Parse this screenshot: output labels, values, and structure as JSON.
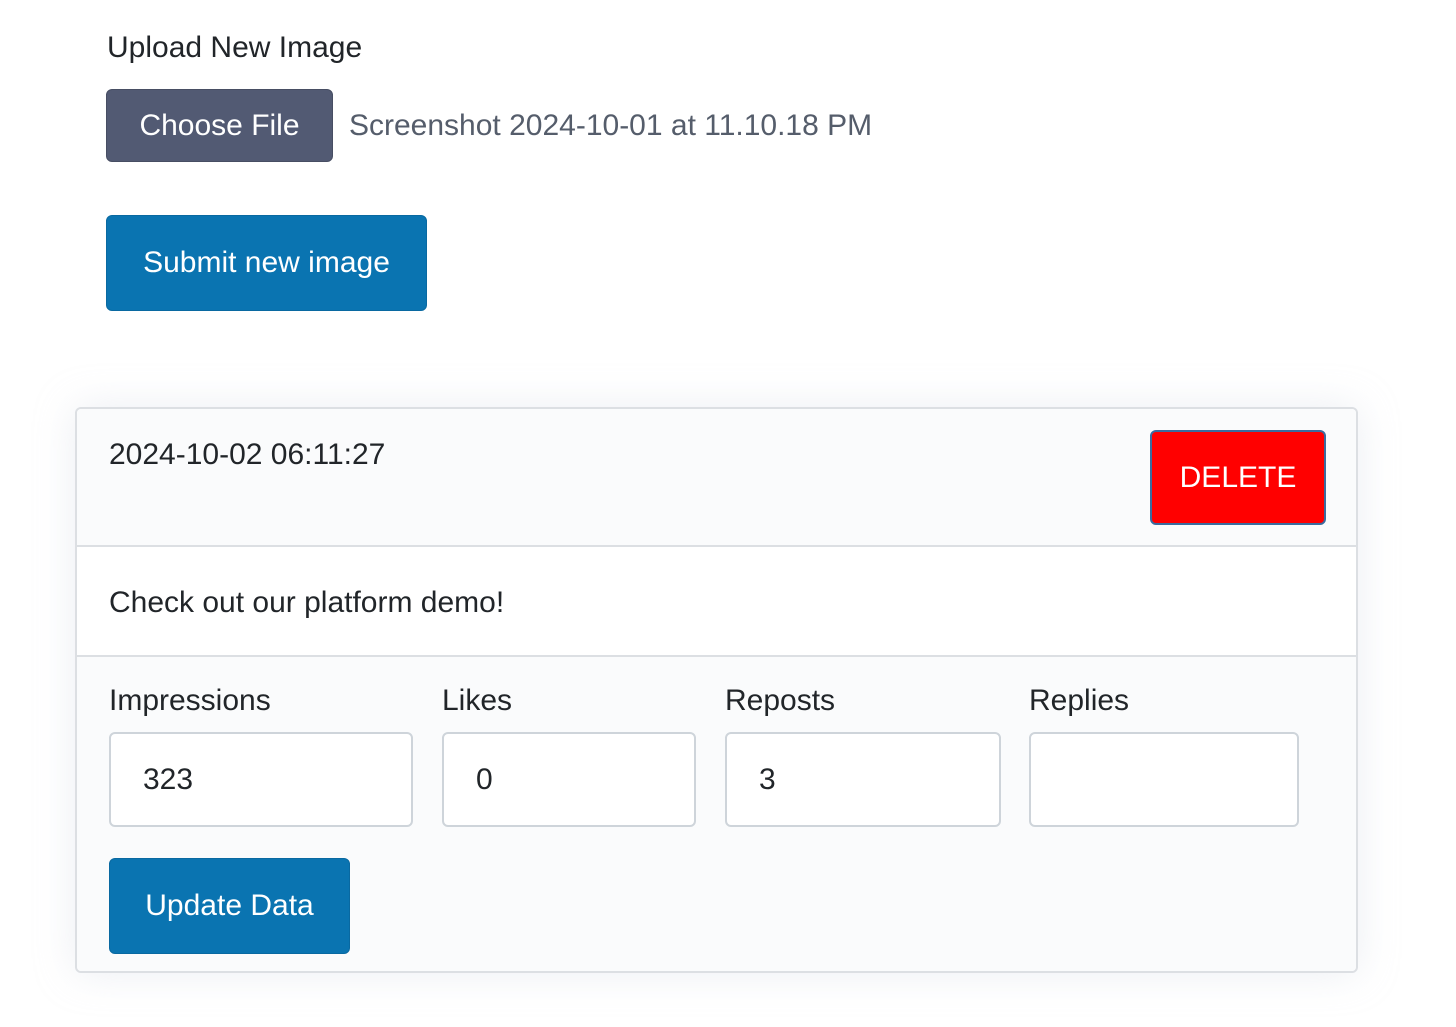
{
  "upload": {
    "label": "Upload New Image",
    "choose_file_label": "Choose File",
    "file_name": "Screenshot 2024-10-01 at 11.10.18 PM",
    "submit_label": "Submit new image"
  },
  "post": {
    "timestamp": "2024-10-02 06:11:27",
    "delete_label": "DELETE",
    "text": "Check out our platform demo!",
    "metrics": {
      "impressions": {
        "label": "Impressions",
        "value": "323"
      },
      "likes": {
        "label": "Likes",
        "value": "0"
      },
      "reposts": {
        "label": "Reposts",
        "value": "3"
      },
      "replies": {
        "label": "Replies",
        "value": ""
      }
    },
    "update_label": "Update Data"
  },
  "colors": {
    "primary": "#0a74b1",
    "secondary": "#525a73",
    "danger": "#ff0000"
  }
}
